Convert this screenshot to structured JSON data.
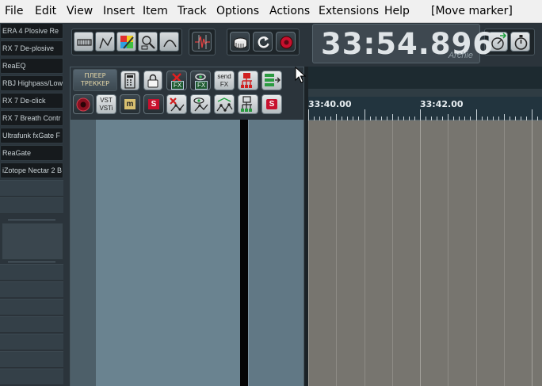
{
  "menu": {
    "items": [
      "File",
      "Edit",
      "View",
      "Insert",
      "Item",
      "Track",
      "Options",
      "Actions",
      "Extensions",
      "Help"
    ],
    "action_status": "[Move marker]"
  },
  "fx_chain": {
    "items": [
      "ERA 4 Plosive Re",
      "RX 7 De-plosive",
      "ReaEQ",
      "RBJ Highpass/Low",
      "RX 7 De-click",
      "RX 7 Breath Contr",
      "Ultrafunk fxGate F",
      "ReaGate",
      "iZotope Nectar 2 B"
    ]
  },
  "toolbar": {
    "player_tracker_line1": "ПЛЕЕР",
    "player_tracker_line2": "ТРЕККЕР",
    "fx_label": "FX",
    "send_fx_line1": "send",
    "send_fx_line2": "FX",
    "vst_line1": "VST",
    "vst_line2": "VSTi",
    "mute_label": "m",
    "solo_label": "S"
  },
  "transport": {
    "time": "33:54.896",
    "state": "Archie"
  },
  "ruler": {
    "labels": [
      "33:40.00",
      "33:42.00"
    ]
  },
  "colors": {
    "accent_red": "#c8102e",
    "arrange_bg": "#77756f"
  }
}
